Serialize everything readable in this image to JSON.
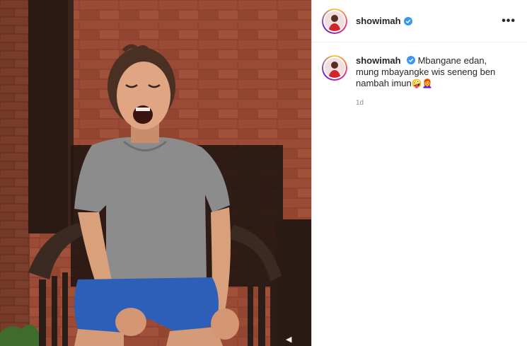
{
  "post": {
    "username": "showimah",
    "verified": true,
    "more_icon": "more-horizontal-icon",
    "more_label": "•••"
  },
  "caption": {
    "username": "showimah",
    "text": "Mbangane edan, mung mbayangke wis seneng ben nambah imun",
    "emoji": "🤪👩‍🦰",
    "timestamp": "1d"
  },
  "media": {
    "type": "video-frame",
    "bottom_icon": "audio-icon"
  },
  "colors": {
    "text": "#262626",
    "secondary": "#8e8e8e",
    "verified": "#3897f0",
    "divider": "#efefef"
  }
}
